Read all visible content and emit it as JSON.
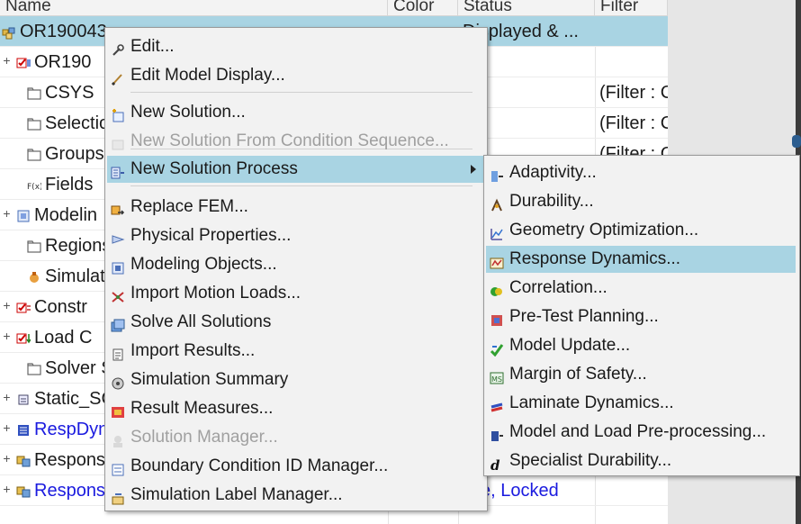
{
  "tree": {
    "columns": [
      "Name",
      "Color",
      "Status",
      "Filter"
    ],
    "rows": [
      {
        "name": "OR190043",
        "status": "Displayed & ...",
        "filter": "",
        "icon": "sim-file-icon",
        "selected": true
      },
      {
        "name": "OR190",
        "status": "",
        "filter": "",
        "icon": "fem-checkbox-icon"
      },
      {
        "name": "CSYS",
        "status": "",
        "filter": "(Filter : C",
        "icon": "folder-icon"
      },
      {
        "name": "Selection",
        "status": "",
        "filter": "(Filter : C",
        "icon": "folder-icon"
      },
      {
        "name": "Groups",
        "status": "",
        "filter": "(Filter : C",
        "icon": "folder-icon"
      },
      {
        "name": "Fields",
        "status": "",
        "filter": "",
        "icon": "fields-icon"
      },
      {
        "name": "Modelin",
        "status": "",
        "filter": "",
        "icon": "modeling-icon"
      },
      {
        "name": "Regions",
        "status": "",
        "filter": "",
        "icon": "folder-icon"
      },
      {
        "name": "Simulatio",
        "status": "",
        "filter": "",
        "icon": "simulation-icon"
      },
      {
        "name": "Constr",
        "status": "",
        "filter": "",
        "icon": "constraint-icon"
      },
      {
        "name": "Load C",
        "status": "",
        "filter": "",
        "icon": "load-icon"
      },
      {
        "name": "Solver Se",
        "status": "",
        "filter": "",
        "icon": "folder-icon"
      },
      {
        "name": "Static_SC",
        "status": "",
        "filter": "",
        "icon": "solution-icon"
      },
      {
        "name": "RespDyn",
        "status": "",
        "filter": "",
        "icon": "respdyn-icon",
        "blue": true
      },
      {
        "name": "Respons",
        "status": "",
        "filter": "",
        "icon": "response-icon"
      },
      {
        "name": "Respons",
        "status": "tive, Locked",
        "filter": "",
        "icon": "response-icon",
        "blue": true
      }
    ]
  },
  "context_menu": {
    "items": [
      {
        "label": "Edit...",
        "icon": "wrench-icon",
        "enabled": true
      },
      {
        "label": "Edit Model Display...",
        "icon": "brush-icon",
        "enabled": true
      },
      {
        "label": "New Solution...",
        "icon": "new-solution-icon",
        "enabled": true
      },
      {
        "label": "New Solution From Condition Sequence...",
        "icon": "condition-sequence-icon",
        "enabled": false
      },
      {
        "label": "New Solution Process",
        "icon": "solution-process-icon",
        "enabled": true,
        "submenu": true,
        "highlighted": true
      },
      {
        "label": "Replace FEM...",
        "icon": "replace-fem-icon",
        "enabled": true
      },
      {
        "label": "Physical Properties...",
        "icon": "physical-properties-icon",
        "enabled": true
      },
      {
        "label": "Modeling Objects...",
        "icon": "modeling-objects-icon",
        "enabled": true
      },
      {
        "label": "Import Motion Loads...",
        "icon": "motion-loads-icon",
        "enabled": true
      },
      {
        "label": "Solve All Solutions",
        "icon": "solve-all-icon",
        "enabled": true
      },
      {
        "label": "Import Results...",
        "icon": "import-results-icon",
        "enabled": true
      },
      {
        "label": "Simulation Summary",
        "icon": "summary-icon",
        "enabled": true
      },
      {
        "label": "Result Measures...",
        "icon": "result-measures-icon",
        "enabled": true
      },
      {
        "label": "Solution Manager...",
        "icon": "solution-manager-icon",
        "enabled": false
      },
      {
        "label": "Boundary Condition ID Manager...",
        "icon": "bc-id-manager-icon",
        "enabled": true
      },
      {
        "label": "Simulation Label Manager...",
        "icon": "label-manager-icon",
        "enabled": true
      }
    ]
  },
  "submenu": {
    "items": [
      {
        "label": "Adaptivity...",
        "icon": "adaptivity-icon"
      },
      {
        "label": "Durability...",
        "icon": "durability-icon"
      },
      {
        "label": "Geometry Optimization...",
        "icon": "geometry-optimization-icon"
      },
      {
        "label": "Response Dynamics...",
        "icon": "response-dynamics-icon",
        "highlighted": true
      },
      {
        "label": "Correlation...",
        "icon": "correlation-icon"
      },
      {
        "label": "Pre-Test Planning...",
        "icon": "pre-test-planning-icon"
      },
      {
        "label": "Model Update...",
        "icon": "model-update-icon"
      },
      {
        "label": "Margin of Safety...",
        "icon": "margin-of-safety-icon"
      },
      {
        "label": "Laminate Dynamics...",
        "icon": "laminate-dynamics-icon"
      },
      {
        "label": "Model and Load Pre-processing...",
        "icon": "pre-processing-icon"
      },
      {
        "label": "Specialist Durability...",
        "icon": "specialist-durability-icon"
      }
    ]
  },
  "colors": {
    "selection": "#a9d4e3",
    "disabled_text": "#a0a0a0",
    "link_blue": "#1a1adf"
  }
}
